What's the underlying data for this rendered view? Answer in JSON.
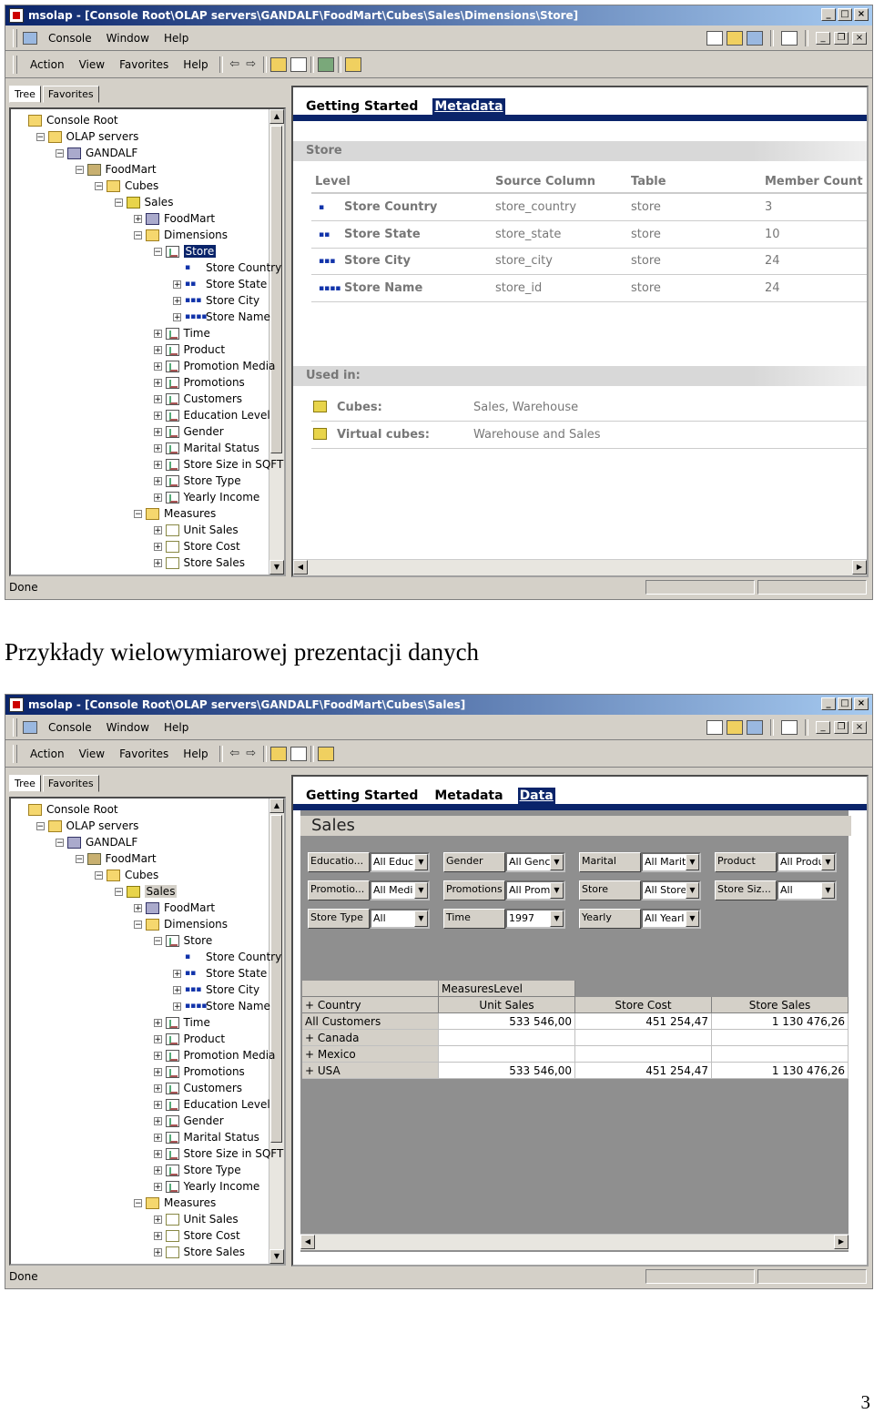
{
  "window1": {
    "title": "msolap - [Console Root\\OLAP servers\\GANDALF\\FoodMart\\Cubes\\Sales\\Dimensions\\Store]",
    "menu": [
      "Console",
      "Window",
      "Help"
    ],
    "actionmenu": [
      "Action",
      "View",
      "Favorites",
      "Help"
    ],
    "tabs": [
      "Tree",
      "Favorites"
    ],
    "taskpad_links": [
      "Getting Started",
      "Metadata"
    ],
    "active_link": "Metadata",
    "store_section": "Store",
    "columns": [
      "Level",
      "Source Column",
      "Table",
      "Member Count"
    ],
    "levels": [
      {
        "dots": "▪",
        "name": "Store Country",
        "source": "store_country",
        "table": "store",
        "count": "3"
      },
      {
        "dots": "▪▪",
        "name": "Store State",
        "source": "store_state",
        "table": "store",
        "count": "10"
      },
      {
        "dots": "▪▪▪",
        "name": "Store City",
        "source": "store_city",
        "table": "store",
        "count": "24"
      },
      {
        "dots": "▪▪▪▪",
        "name": "Store Name",
        "source": "store_id",
        "table": "store",
        "count": "24"
      }
    ],
    "used_in_section": "Used in:",
    "used_in": [
      {
        "label": "Cubes:",
        "value": "Sales, Warehouse"
      },
      {
        "label": "Virtual cubes:",
        "value": "Warehouse and Sales"
      }
    ],
    "status": "Done"
  },
  "window2": {
    "title": "msolap - [Console Root\\OLAP servers\\GANDALF\\FoodMart\\Cubes\\Sales]",
    "taskpad_links": [
      "Getting Started",
      "Metadata",
      "Data"
    ],
    "active_link": "Data",
    "data_title": "Sales",
    "filters": [
      [
        {
          "label": "Educatio...",
          "value": "All Educ"
        },
        {
          "label": "Gender",
          "value": "All Genc"
        },
        {
          "label": "Marital",
          "value": "All Marit"
        },
        {
          "label": "Product",
          "value": "All Produ"
        }
      ],
      [
        {
          "label": "Promotio...",
          "value": "All Medi"
        },
        {
          "label": "Promotions",
          "value": "All Prom"
        },
        {
          "label": "Store",
          "value": "All Store"
        },
        {
          "label": "Store Siz...",
          "value": "All"
        }
      ],
      [
        {
          "label": "Store Type",
          "value": "All"
        },
        {
          "label": "Time",
          "value": "1997"
        },
        {
          "label": "Yearly",
          "value": "All Yearl"
        }
      ]
    ],
    "pivot": {
      "measures_header": "MeasuresLevel",
      "row_header": "+ Country",
      "columns": [
        "Unit Sales",
        "Store Cost",
        "Store Sales"
      ],
      "rows": [
        {
          "label": "All Customers",
          "values": [
            "533 546,00",
            "451 254,47",
            "1 130 476,26"
          ]
        },
        {
          "label": "+  Canada",
          "values": [
            "",
            "",
            ""
          ]
        },
        {
          "label": "+  Mexico",
          "values": [
            "",
            "",
            ""
          ]
        },
        {
          "label": "+  USA",
          "values": [
            "533 546,00",
            "451 254,47",
            "1 130 476,26"
          ]
        }
      ]
    },
    "status": "Done"
  },
  "tree": [
    {
      "label": "Console Root",
      "icon": "folder-icon",
      "exp": ""
    },
    {
      "label": "OLAP servers",
      "icon": "folder-icon",
      "exp": "-"
    },
    {
      "label": "GANDALF",
      "icon": "server-icon",
      "exp": "-"
    },
    {
      "label": "FoodMart",
      "icon": "database-icon",
      "exp": "-"
    },
    {
      "label": "Cubes",
      "icon": "folder-icon",
      "exp": "-"
    },
    {
      "label": "Sales",
      "icon": "cube-icon",
      "exp": "-"
    },
    {
      "label": "FoodMart",
      "icon": "globe-icon",
      "exp": "+"
    },
    {
      "label": "Dimensions",
      "icon": "folder-icon",
      "exp": "-"
    },
    {
      "label": "Store",
      "icon": "dimension-icon",
      "exp": "-"
    },
    {
      "label": "Store Country",
      "icon": "level-icon",
      "exp": ""
    },
    {
      "label": "Store State",
      "icon": "level-icon",
      "exp": "+"
    },
    {
      "label": "Store City",
      "icon": "level-icon",
      "exp": "+"
    },
    {
      "label": "Store Name",
      "icon": "level-icon",
      "exp": "+"
    },
    {
      "label": "Time",
      "icon": "dimension-icon",
      "exp": "+"
    },
    {
      "label": "Product",
      "icon": "dimension-icon",
      "exp": "+"
    },
    {
      "label": "Promotion Media",
      "icon": "dimension-icon",
      "exp": "+"
    },
    {
      "label": "Promotions",
      "icon": "dimension-icon",
      "exp": "+"
    },
    {
      "label": "Customers",
      "icon": "dimension-icon",
      "exp": "+"
    },
    {
      "label": "Education Level",
      "icon": "dimension-icon",
      "exp": "+"
    },
    {
      "label": "Gender",
      "icon": "dimension-icon",
      "exp": "+"
    },
    {
      "label": "Marital Status",
      "icon": "dimension-icon",
      "exp": "+"
    },
    {
      "label": "Store Size in SQFT",
      "icon": "dimension-icon",
      "exp": "+"
    },
    {
      "label": "Store Type",
      "icon": "dimension-icon",
      "exp": "+"
    },
    {
      "label": "Yearly Income",
      "icon": "dimension-icon",
      "exp": "+"
    },
    {
      "label": "Measures",
      "icon": "folder-icon",
      "exp": "-"
    },
    {
      "label": "Unit Sales",
      "icon": "measure-icon",
      "exp": "+"
    },
    {
      "label": "Store Cost",
      "icon": "measure-icon",
      "exp": "+"
    },
    {
      "label": "Store Sales",
      "icon": "measure-icon",
      "exp": "+"
    }
  ],
  "caption": "Przykłady wielowymiarowej prezentacji danych",
  "page_number": "3"
}
